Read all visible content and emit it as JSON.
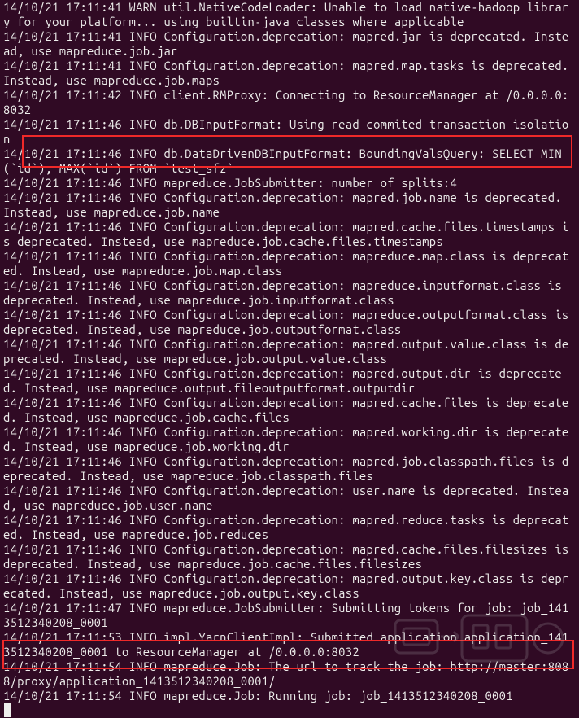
{
  "terminal": {
    "lines": [
      "14/10/21 17:11:41 WARN util.NativeCodeLoader: Unable to load native-hadoop library for your platform... using builtin-java classes where applicable",
      "14/10/21 17:11:41 INFO Configuration.deprecation: mapred.jar is deprecated. Instead, use mapreduce.job.jar",
      "14/10/21 17:11:41 INFO Configuration.deprecation: mapred.map.tasks is deprecated. Instead, use mapreduce.job.maps",
      "14/10/21 17:11:42 INFO client.RMProxy: Connecting to ResourceManager at /0.0.0.0:8032",
      "14/10/21 17:11:46 INFO db.DBInputFormat: Using read commited transaction isolation",
      "14/10/21 17:11:46 INFO db.DataDrivenDBInputFormat: BoundingValsQuery: SELECT MIN(`id`), MAX(`id`) FROM `test_sfz`",
      "14/10/21 17:11:46 INFO mapreduce.JobSubmitter: number of splits:4",
      "14/10/21 17:11:46 INFO Configuration.deprecation: mapred.job.name is deprecated. Instead, use mapreduce.job.name",
      "14/10/21 17:11:46 INFO Configuration.deprecation: mapred.cache.files.timestamps is deprecated. Instead, use mapreduce.job.cache.files.timestamps",
      "14/10/21 17:11:46 INFO Configuration.deprecation: mapreduce.map.class is deprecated. Instead, use mapreduce.job.map.class",
      "14/10/21 17:11:46 INFO Configuration.deprecation: mapreduce.inputformat.class is deprecated. Instead, use mapreduce.job.inputformat.class",
      "14/10/21 17:11:46 INFO Configuration.deprecation: mapreduce.outputformat.class is deprecated. Instead, use mapreduce.job.outputformat.class",
      "14/10/21 17:11:46 INFO Configuration.deprecation: mapred.output.value.class is deprecated. Instead, use mapreduce.job.output.value.class",
      "14/10/21 17:11:46 INFO Configuration.deprecation: mapred.output.dir is deprecated. Instead, use mapreduce.output.fileoutputformat.outputdir",
      "14/10/21 17:11:46 INFO Configuration.deprecation: mapred.cache.files is deprecated. Instead, use mapreduce.job.cache.files",
      "14/10/21 17:11:46 INFO Configuration.deprecation: mapred.working.dir is deprecated. Instead, use mapreduce.job.working.dir",
      "14/10/21 17:11:46 INFO Configuration.deprecation: mapred.job.classpath.files is deprecated. Instead, use mapreduce.job.classpath.files",
      "14/10/21 17:11:46 INFO Configuration.deprecation: user.name is deprecated. Instead, use mapreduce.job.user.name",
      "14/10/21 17:11:46 INFO Configuration.deprecation: mapred.reduce.tasks is deprecated. Instead, use mapreduce.job.reduces",
      "14/10/21 17:11:46 INFO Configuration.deprecation: mapred.cache.files.filesizes is deprecated. Instead, use mapreduce.job.cache.files.filesizes",
      "14/10/21 17:11:46 INFO Configuration.deprecation: mapred.output.key.class is deprecated. Instead, use mapreduce.job.output.key.class",
      "14/10/21 17:11:47 INFO mapreduce.JobSubmitter: Submitting tokens for job: job_1413512340208_0001",
      "14/10/21 17:11:53 INFO impl.YarnClientImpl: Submitted application application_1413512340208_0001 to ResourceManager at /0.0.0.0:8032",
      "14/10/21 17:11:54 INFO mapreduce.Job: The url to track the job: http://master:8088/proxy/application_1413512340208_0001/",
      "14/10/21 17:11:54 INFO mapreduce.Job: Running job: job_1413512340208_0001"
    ]
  },
  "highlights": {
    "box1": "bounding-vals-query-line",
    "box2": "running-job-line"
  },
  "colors": {
    "background": "#300a24",
    "foreground": "#eeeeec",
    "highlight": "#ef2929"
  }
}
